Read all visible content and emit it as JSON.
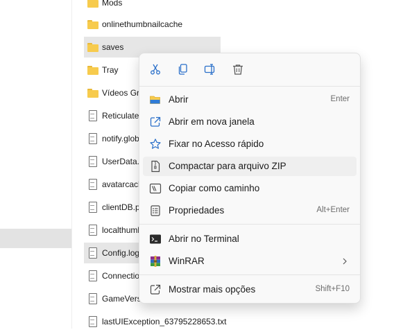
{
  "explorer": {
    "files": [
      {
        "name": "Mods",
        "type": "folder"
      },
      {
        "name": "onlinethumbnailcache",
        "type": "folder"
      },
      {
        "name": "saves",
        "type": "folder"
      },
      {
        "name": "Tray",
        "type": "folder"
      },
      {
        "name": "Vídeos Gra",
        "type": "folder"
      },
      {
        "name": "Reticulatec",
        "type": "file"
      },
      {
        "name": "notify.glob",
        "type": "file"
      },
      {
        "name": "UserData.lo",
        "type": "file"
      },
      {
        "name": "avatarcach",
        "type": "file"
      },
      {
        "name": "clientDB.pa",
        "type": "file"
      },
      {
        "name": "localthumb",
        "type": "file"
      },
      {
        "name": "Config.log",
        "type": "file"
      },
      {
        "name": "Connectio",
        "type": "file"
      },
      {
        "name": "GameVersio",
        "type": "file"
      },
      {
        "name": "lastUIException_63795228653.txt",
        "type": "file"
      }
    ]
  },
  "context_menu": {
    "quick_actions": [
      {
        "name": "cut",
        "icon": "scissors-icon"
      },
      {
        "name": "copy",
        "icon": "copy-icon"
      },
      {
        "name": "rename",
        "icon": "rename-icon"
      },
      {
        "name": "delete",
        "icon": "trash-icon"
      }
    ],
    "open": {
      "label": "Abrir",
      "shortcut": "Enter"
    },
    "open_new_window": {
      "label": "Abrir em nova janela"
    },
    "pin_quick_access": {
      "label": "Fixar no Acesso rápido"
    },
    "compress_zip": {
      "label": "Compactar para arquivo ZIP"
    },
    "copy_as_path": {
      "label": "Copiar como caminho"
    },
    "properties": {
      "label": "Propriedades",
      "shortcut": "Alt+Enter"
    },
    "open_terminal": {
      "label": "Abrir no Terminal"
    },
    "winrar": {
      "label": "WinRAR"
    },
    "more_options": {
      "label": "Mostrar mais opções",
      "shortcut": "Shift+F10"
    }
  },
  "colors": {
    "accent": "#0067c0",
    "folder": "#f7cb4d",
    "menu_bg": "#f9f9f9"
  }
}
